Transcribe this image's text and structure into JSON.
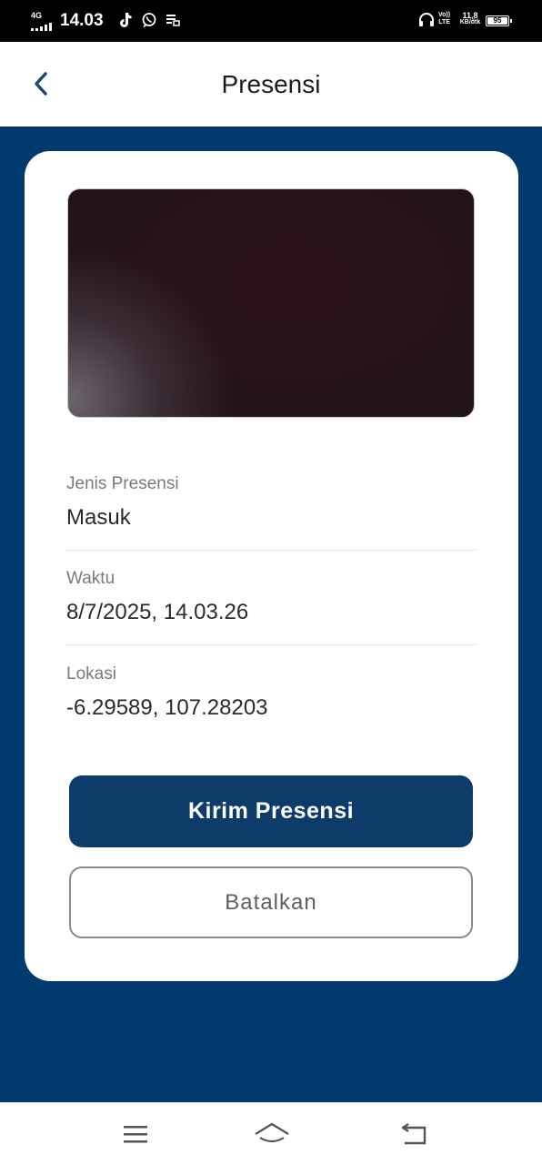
{
  "status_bar": {
    "network": "4G",
    "time": "14.03",
    "volte_line1": "Vo))",
    "volte_line2": "LTE",
    "speed_value": "11,8",
    "speed_unit": "KB/dtk",
    "battery": "95",
    "icons": [
      "tiktok-icon",
      "whatsapp-icon",
      "notification-icon",
      "headphones-icon"
    ]
  },
  "app_bar": {
    "title": "Presensi",
    "back_icon": "chevron-left-icon"
  },
  "form": {
    "photo": "camera-preview",
    "fields": [
      {
        "label": "Jenis Presensi",
        "value": "Masuk"
      },
      {
        "label": "Waktu",
        "value": "8/7/2025, 14.03.26"
      },
      {
        "label": "Lokasi",
        "value": "-6.29589, 107.28203"
      }
    ]
  },
  "actions": {
    "submit_label": "Kirim Presensi",
    "cancel_label": "Batalkan"
  },
  "nav_bar": {
    "icons": [
      "menu-icon",
      "home-icon",
      "back-icon"
    ]
  },
  "colors": {
    "primary": "#0d3c6b",
    "background": "#013a6d",
    "card": "#ffffff"
  }
}
